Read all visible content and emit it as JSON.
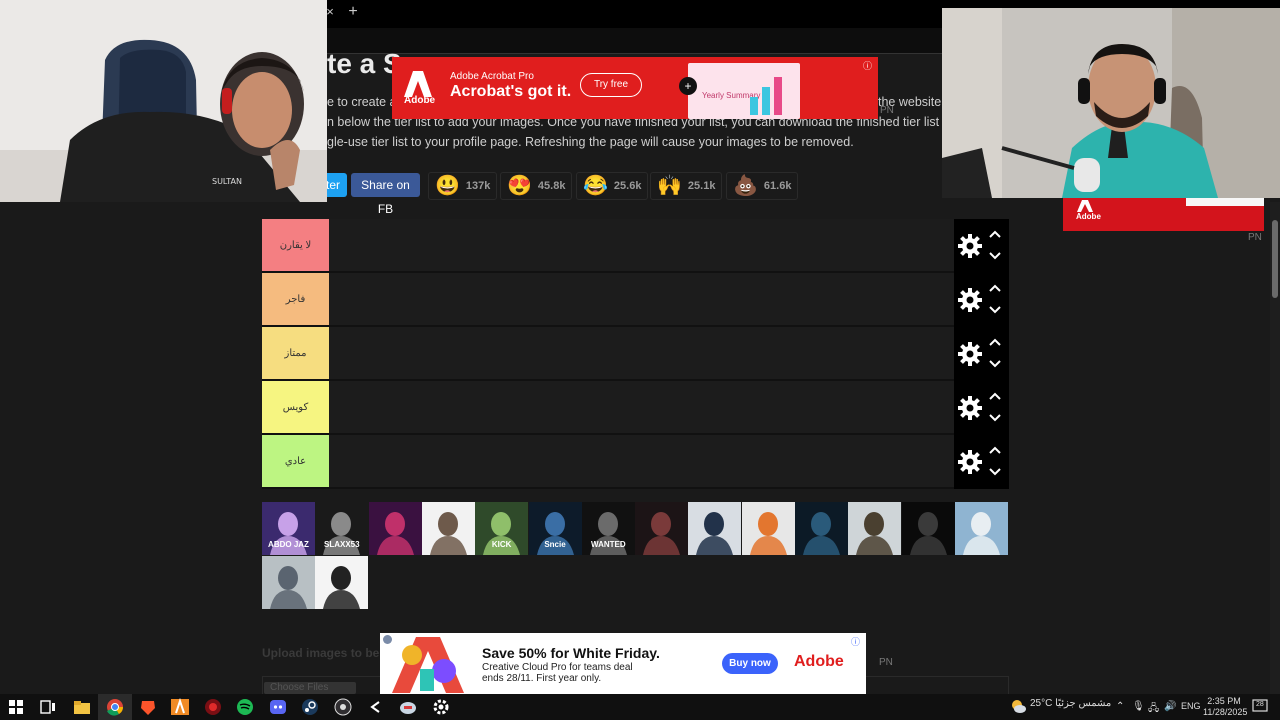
{
  "browser": {
    "tab_close": "×",
    "new_tab": "+"
  },
  "page": {
    "title": "te a S",
    "intro": [
      "e to create a s",
      "n below the tier list to add your images. Once you have finished your list, you can download the finished tier list image. It is",
      "gle-use tier list to your profile page. Refreshing the page will cause your images to be removed."
    ],
    "intro_right": "the website.",
    "share": {
      "twitter": "itter",
      "facebook": "Share on FB"
    },
    "reactions": [
      {
        "emoji": "😃",
        "count": "137k"
      },
      {
        "emoji": "😍",
        "count": "45.8k"
      },
      {
        "emoji": "😂",
        "count": "25.6k"
      },
      {
        "emoji": "🙌",
        "count": "25.1k"
      },
      {
        "emoji": "💩",
        "count": "61.6k"
      }
    ]
  },
  "tiers": [
    {
      "label": "لا يقارن",
      "color": "#f47f82"
    },
    {
      "label": "فاجر",
      "color": "#f5bb7f"
    },
    {
      "label": "ممتاز",
      "color": "#f6dd80"
    },
    {
      "label": "كويس",
      "color": "#f6f581"
    },
    {
      "label": "عادي",
      "color": "#bdf582"
    }
  ],
  "pool": {
    "captions": [
      "ABDO JAZ",
      "SLAXX53",
      "",
      "",
      "KICK",
      "Sncie",
      "WANTED",
      "",
      "",
      "",
      "",
      "",
      "",
      "",
      "",
      ""
    ]
  },
  "bottom": {
    "upload_label": "Upload images to be s",
    "choose_files": "Choose Files"
  },
  "ads": {
    "top": {
      "adobe": "Adobe",
      "product": "Adobe Acrobat Pro",
      "headline": "Acrobat's got it.",
      "cta": "Try free",
      "card_text": "Yearly Summary",
      "pn": "PN"
    },
    "bottom": {
      "headline": "Save 50% for White Friday.",
      "line1": "Creative Cloud Pro for teams deal",
      "line2": "ends 28/11. First year only.",
      "cta": "Buy now",
      "brand": "Adobe",
      "pn": "PN"
    },
    "side": {
      "adobe": "Adobe",
      "pn": "PN"
    }
  },
  "taskbar": {
    "weather": "25°C  مشمس جزئيًا",
    "lang": "ENG",
    "time": "2:35 PM",
    "date": "11/28/2025",
    "notifications": "28"
  }
}
